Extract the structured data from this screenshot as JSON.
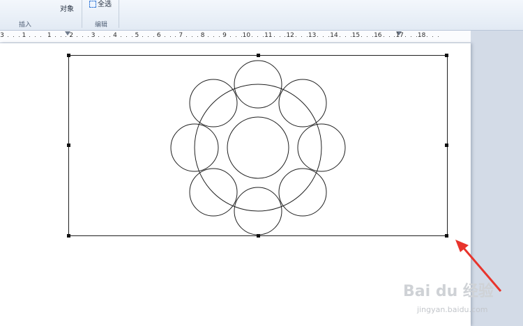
{
  "ribbon": {
    "object_button": "对象",
    "select_all_button": "全选",
    "groups": {
      "insert": "插入",
      "edit": "编辑"
    }
  },
  "ruler": {
    "labels": [
      "3",
      "1",
      "1",
      "2",
      "3",
      "4",
      "5",
      "6",
      "7",
      "8",
      "9",
      "10",
      "11",
      "12",
      "13",
      "14",
      "15",
      "16",
      "17",
      "18"
    ]
  },
  "watermark": {
    "logo": "Bai du 经验",
    "url": "jingyan.baidu.com"
  },
  "colors": {
    "annotation_arrow": "#e8342c",
    "stroke": "#1e1e1e"
  }
}
